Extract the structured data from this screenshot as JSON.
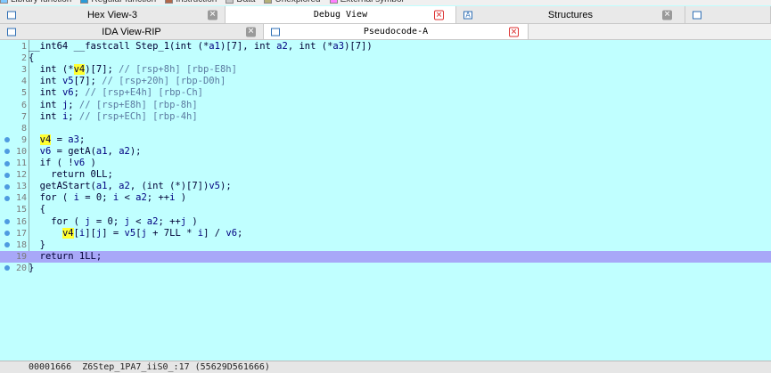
{
  "legend": [
    {
      "label": "Library function",
      "color": "#7ec8ff"
    },
    {
      "label": "Regular function",
      "color": "#2b9bd8"
    },
    {
      "label": "Instruction",
      "color": "#b0684a"
    },
    {
      "label": "Data",
      "color": "#c8c8c8"
    },
    {
      "label": "Unexplored",
      "color": "#b4b07a"
    },
    {
      "label": "External symbol",
      "color": "#ff80ff"
    }
  ],
  "tabs_row1": [
    {
      "label": "Hex View-3",
      "icon": "hex-view-icon"
    },
    {
      "label": "Debug View",
      "icon": ""
    },
    {
      "label": "Structures",
      "icon": "structures-icon"
    },
    {
      "label": "",
      "icon": "enums-icon"
    }
  ],
  "tabs_row2": [
    {
      "label": "IDA View-RIP",
      "icon": "ida-view-icon"
    },
    {
      "label": "Pseudocode-A",
      "icon": "pseudocode-icon"
    }
  ],
  "code_lines": [
    {
      "n": "1",
      "text": "__int64 __fastcall Step_1(int (*a1)[7], int a2, int (*a3)[7])"
    },
    {
      "n": "2",
      "text": "{"
    },
    {
      "n": "3",
      "text": "  int (*v4)[7]; // [rsp+8h] [rbp-E8h]"
    },
    {
      "n": "4",
      "text": "  int v5[7]; // [rsp+20h] [rbp-D0h]"
    },
    {
      "n": "5",
      "text": "  int v6; // [rsp+E4h] [rbp-Ch]"
    },
    {
      "n": "6",
      "text": "  int j; // [rsp+E8h] [rbp-8h]"
    },
    {
      "n": "7",
      "text": "  int i; // [rsp+ECh] [rbp-4h]"
    },
    {
      "n": "8",
      "text": ""
    },
    {
      "n": "9",
      "text": "  v4 = a3;"
    },
    {
      "n": "10",
      "text": "  v6 = getA(a1, a2);"
    },
    {
      "n": "11",
      "text": "  if ( !v6 )"
    },
    {
      "n": "12",
      "text": "    return 0LL;"
    },
    {
      "n": "13",
      "text": "  getAStart(a1, a2, (int (*)[7])v5);"
    },
    {
      "n": "14",
      "text": "  for ( i = 0; i < a2; ++i )"
    },
    {
      "n": "15",
      "text": "  {"
    },
    {
      "n": "16",
      "text": "    for ( j = 0; j < a2; ++j )"
    },
    {
      "n": "17",
      "text": "      v4[i][j] = v5[j + 7LL * i] / v6;"
    },
    {
      "n": "18",
      "text": "  }"
    },
    {
      "n": "19",
      "text": "  return 1LL;"
    },
    {
      "n": "20",
      "text": "}"
    }
  ],
  "status": {
    "text": "00001666  Z6Step_1PA7_iiS0_:17 (55629D561666)"
  }
}
